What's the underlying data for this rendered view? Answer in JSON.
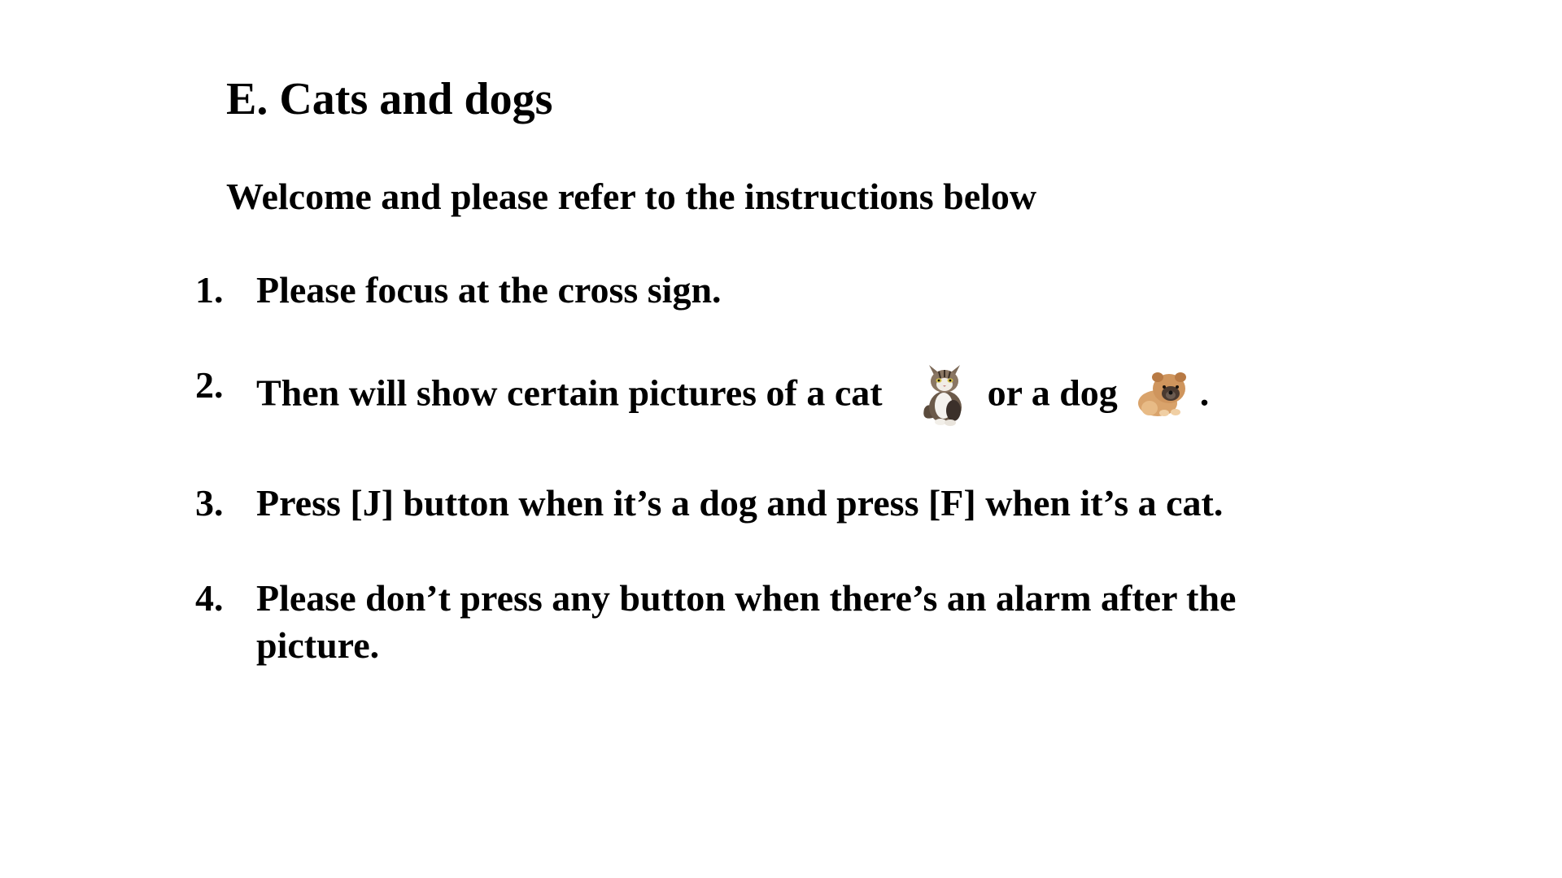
{
  "title": "E. Cats and dogs",
  "subtitle": "Welcome and please refer to the instructions below",
  "instructions": [
    {
      "number": "1.",
      "text": "Please focus at the cross sign."
    },
    {
      "number": "2.",
      "text_before": "Then will show certain pictures of a cat",
      "text_middle": "or a dog",
      "text_after": ".",
      "images": [
        "cat-picture",
        "dog-picture"
      ]
    },
    {
      "number": "3.",
      "text": "Press [J] button when it’s a dog and press [F] when it’s a cat."
    },
    {
      "number": "4.",
      "text": "Please don’t press any button when there’s an alarm after the picture."
    }
  ]
}
